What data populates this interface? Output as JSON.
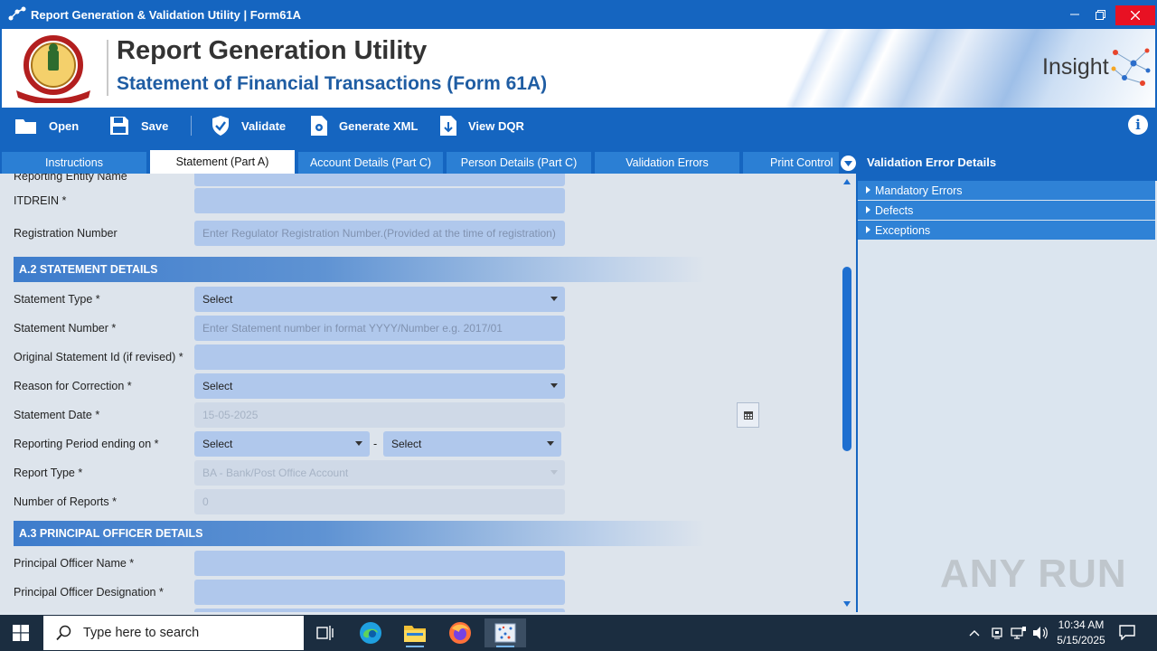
{
  "window": {
    "title": "Report Generation & Validation Utility | Form61A"
  },
  "banner": {
    "title": "Report Generation Utility",
    "subtitle": "Statement of Financial Transactions (Form 61A)",
    "brand": "Insight",
    "emblem_text": "INCOME TAX DEPARTMENT"
  },
  "toolbar": {
    "open": "Open",
    "save": "Save",
    "validate": "Validate",
    "generate_xml": "Generate XML",
    "view_dqr": "View DQR"
  },
  "tabs": [
    {
      "label": "Instructions",
      "active": false
    },
    {
      "label": "Statement (Part A)",
      "active": true
    },
    {
      "label": "Account Details (Part C)",
      "active": false
    },
    {
      "label": "Person Details (Part C)",
      "active": false
    },
    {
      "label": "Validation Errors",
      "active": false
    },
    {
      "label": "Print Control",
      "active": false
    }
  ],
  "form": {
    "cut_label": "Reporting Entity Name",
    "itdrein": {
      "label": "ITDREIN *",
      "value": ""
    },
    "registration": {
      "label": "Registration Number",
      "placeholder": "Enter Regulator Registration Number.(Provided at the time of registration)"
    },
    "section_a2": "A.2 STATEMENT DETAILS",
    "statement_type": {
      "label": "Statement Type *",
      "value": "Select"
    },
    "statement_number": {
      "label": "Statement Number *",
      "placeholder": "Enter Statement number in format YYYY/Number e.g. 2017/01"
    },
    "original_statement": {
      "label": "Original Statement Id (if revised) *",
      "value": ""
    },
    "reason_correction": {
      "label": "Reason for Correction *",
      "value": "Select"
    },
    "statement_date": {
      "label": "Statement Date *",
      "value": "15-05-2025"
    },
    "reporting_period": {
      "label": "Reporting Period ending on *",
      "value1": "Select",
      "separator": "-",
      "value2": "Select"
    },
    "report_type": {
      "label": "Report Type *",
      "value": "BA - Bank/Post Office Account"
    },
    "number_of_reports": {
      "label": "Number of Reports *",
      "value": "0"
    },
    "section_a3": "A.3 PRINCIPAL OFFICER DETAILS",
    "po_name": {
      "label": "Principal Officer Name *",
      "value": ""
    },
    "po_designation": {
      "label": "Principal Officer Designation *",
      "value": ""
    }
  },
  "validation_panel": {
    "header": "Validation Error Details",
    "items": [
      "Mandatory Errors",
      "Defects",
      "Exceptions"
    ]
  },
  "watermark": "ANY RUN",
  "taskbar": {
    "search_placeholder": "Type here to search",
    "time": "10:34 AM",
    "date": "5/15/2025"
  }
}
